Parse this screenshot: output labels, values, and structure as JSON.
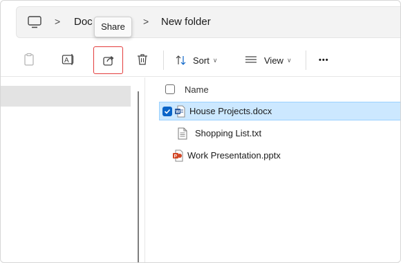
{
  "breadcrumb": {
    "items": [
      "Doc",
      "New folder"
    ],
    "separator": ">"
  },
  "tooltip": {
    "text": "Share"
  },
  "toolbar": {
    "sort_label": "Sort",
    "view_label": "View",
    "more_label": "•••",
    "icons": [
      "paste-icon",
      "rename-icon",
      "share-icon",
      "delete-icon",
      "sort-icon",
      "view-icon",
      "more-icon"
    ]
  },
  "file_list": {
    "column_name": "Name",
    "files": [
      {
        "name": "House Projects.docx",
        "type": "word",
        "selected": true
      },
      {
        "name": "Shopping List.txt",
        "type": "text",
        "selected": false
      },
      {
        "name": "Work Presentation.pptx",
        "type": "powerpoint",
        "selected": false
      }
    ]
  },
  "colors": {
    "selection_bg": "#cce8ff",
    "accent_blue": "#0a64c8",
    "highlight_red": "#e33b3b",
    "word_blue": "#2b579a",
    "ppt_orange": "#d24726"
  }
}
